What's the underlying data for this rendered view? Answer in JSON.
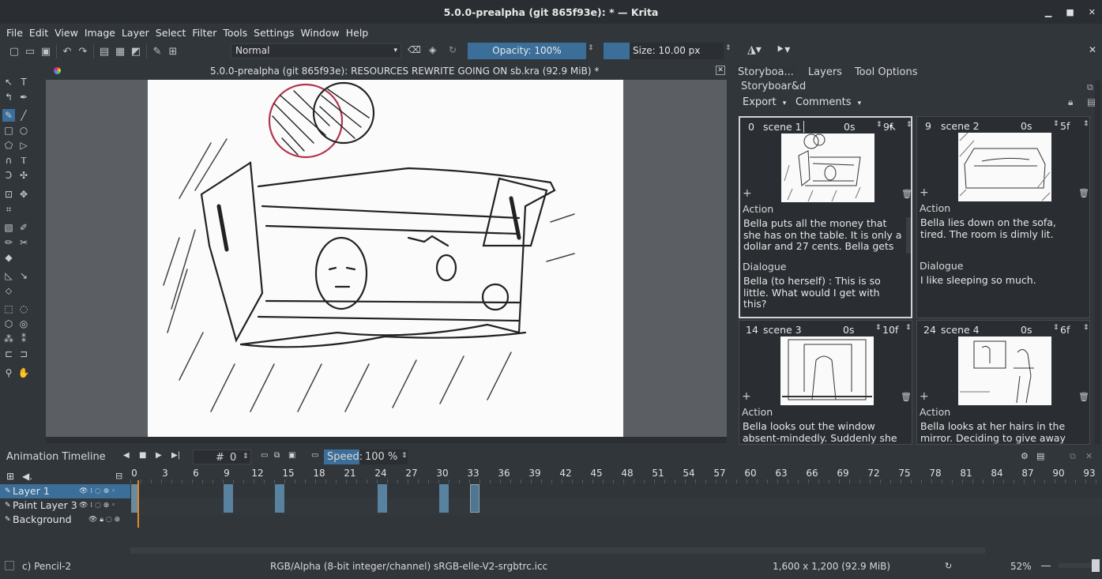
{
  "window": {
    "title": "5.0.0-prealpha (git 865f93e): * — Krita"
  },
  "menu": [
    {
      "label": "File"
    },
    {
      "label": "Edit"
    },
    {
      "label": "View"
    },
    {
      "label": "Image"
    },
    {
      "label": "Layer"
    },
    {
      "label": "Select"
    },
    {
      "label": "Filter"
    },
    {
      "label": "Tools"
    },
    {
      "label": "Settings"
    },
    {
      "label": "Window"
    },
    {
      "label": "Help"
    }
  ],
  "toolbar": {
    "blend_mode": "Normal",
    "opacity": "Opacity: 100%",
    "opacity_value": 1.0,
    "size": "Size: 10.00 px"
  },
  "document": {
    "tab_title": "5.0.0-prealpha (git 865f93e): RESOURCES REWRITE GOING ON sb.kra (92.9 MiB) *"
  },
  "dockers": {
    "tabs": [
      "Storyboa...",
      "Layers",
      "Tool Options"
    ],
    "title": "Storyboar&d",
    "export_label": "Export",
    "comments_label": "Comments"
  },
  "storyboard": {
    "scenes": [
      {
        "frame": "0",
        "name": "scene 1",
        "duration_s": "0s",
        "duration_f": "9f",
        "action_label": "Action",
        "action": "Bella puts all the money that she has on the table. It is only a dollar and 27 cents. Bella gets",
        "dialogue_label": "Dialogue",
        "dialogue": "Bella (to herself) : This is so little. What would I get with this?"
      },
      {
        "frame": "9",
        "name": "scene 2",
        "duration_s": "0s",
        "duration_f": "5f",
        "action_label": "Action",
        "action": "Bella lies down on the sofa, tired. The room is dimly lit.",
        "dialogue_label": "Dialogue",
        "dialogue": "I like sleeping so much."
      },
      {
        "frame": "14",
        "name": "scene 3",
        "duration_s": "0s",
        "duration_f": "10f",
        "action_label": "Action",
        "action": "Bella looks out the window absent-mindedly. Suddenly she"
      },
      {
        "frame": "24",
        "name": "scene 4",
        "duration_s": "0s",
        "duration_f": "6f",
        "action_label": "Action",
        "action": "Bella looks at her hairs in the mirror. Deciding to give away"
      }
    ]
  },
  "timeline": {
    "title": "Animation Timeline",
    "frame_label": "#",
    "frame_value": "0",
    "speed_label": "Speed:",
    "speed_value": "100 %",
    "ruler": [
      "0",
      "3",
      "6",
      "9",
      "12",
      "15",
      "18",
      "21",
      "24",
      "27",
      "30",
      "33",
      "36",
      "39",
      "42",
      "45",
      "48",
      "51",
      "54",
      "57",
      "60",
      "63",
      "66",
      "69",
      "72",
      "75",
      "78",
      "81",
      "84",
      "87",
      "90",
      "93"
    ],
    "layers": [
      {
        "name": "Layer 1"
      },
      {
        "name": "Paint Layer 3"
      },
      {
        "name": "Background"
      }
    ],
    "keyframes_layer1": [
      0,
      9,
      14,
      24,
      30,
      33
    ]
  },
  "status": {
    "brush": "c) Pencil-2",
    "color_space": "RGB/Alpha (8-bit integer/channel)  sRGB-elle-V2-srgbtrc.icc",
    "dimensions": "1,600 x 1,200 (92.9 MiB)",
    "zoom": "52%"
  }
}
